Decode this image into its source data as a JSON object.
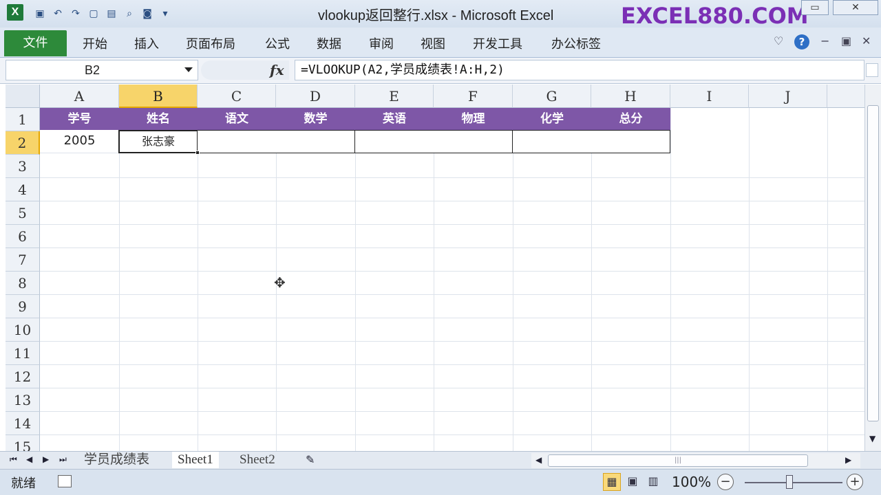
{
  "window": {
    "title": "vlookup返回整行.xlsx - Microsoft Excel",
    "watermark": "EXCEL880.COM",
    "app_icon": "X"
  },
  "ribbon": {
    "file_tab": "文件",
    "tabs": [
      "开始",
      "插入",
      "页面布局",
      "公式",
      "数据",
      "审阅",
      "视图",
      "开发工具",
      "办公标签"
    ]
  },
  "formula_bar": {
    "name_box": "B2",
    "fx_label": "fx",
    "formula": "=VLOOKUP(A2,学员成绩表!A:H,2)"
  },
  "grid": {
    "columns": [
      "A",
      "B",
      "C",
      "D",
      "E",
      "F",
      "G",
      "H",
      "I",
      "J"
    ],
    "rows": [
      "1",
      "2",
      "3",
      "4",
      "5",
      "6",
      "7",
      "8",
      "9",
      "10",
      "11",
      "12",
      "13",
      "14",
      "15"
    ],
    "selected_column": "B",
    "selected_row": "2",
    "header_row": [
      "学号",
      "姓名",
      "语文",
      "数学",
      "英语",
      "物理",
      "化学",
      "总分"
    ],
    "data_row": [
      "2005",
      "张志豪",
      "",
      "",
      "",
      "",
      "",
      ""
    ],
    "header_color": "#7e57a7"
  },
  "sheets": {
    "tabs": [
      "学员成绩表",
      "Sheet1",
      "Sheet2"
    ],
    "active": "Sheet1"
  },
  "status": {
    "ready": "就绪",
    "zoom": "100%"
  }
}
